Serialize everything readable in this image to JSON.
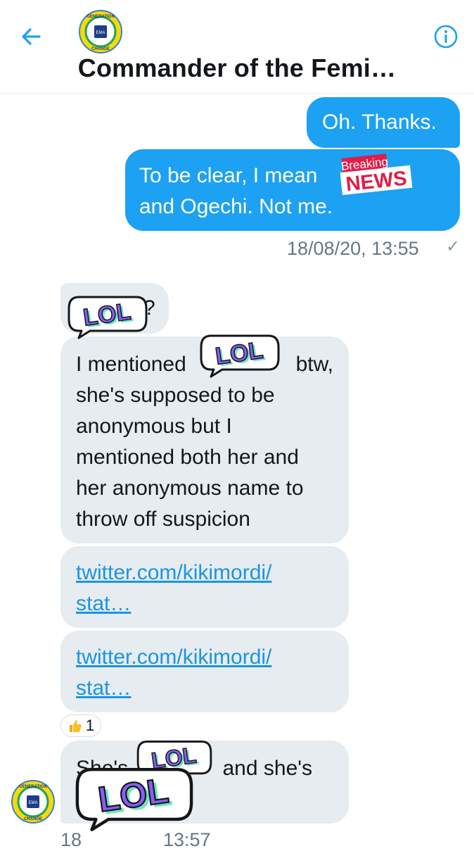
{
  "header": {
    "title": "Commander of the Femi…",
    "avatar_text_top": "GENERATION",
    "avatar_text_bottom": "CHANGE",
    "avatar_badge": "EMA"
  },
  "messages": {
    "out1": "Oh. Thanks.",
    "out2_line1": "To be clear, I mean",
    "out2_line2": "and Ogechi. Not me.",
    "out_timestamp": "18/08/20, 13:55",
    "out_check": "✓",
    "in1_tail": "?",
    "in2_line1_start": "I mentioned",
    "in2_line1_end": "btw,",
    "in2_line2": "she's supposed to be",
    "in2_line3": "anonymous but I",
    "in2_line4": "mentioned both her and",
    "in2_line5": "her anonymous name to",
    "in2_line6": "throw off suspicion",
    "link1_line1": "twitter.com/kikimordi/",
    "link1_line2": "stat…",
    "link2_line1": "twitter.com/kikimordi/",
    "link2_line2": "stat…",
    "reaction_count": "1",
    "in5_start": "She's",
    "in5_end": "and she's",
    "in_timestamp_partial": "18",
    "in_timestamp_partial_end": "13:57"
  },
  "stickers": {
    "lol": "LOL",
    "breaking_top": "Breaking",
    "breaking_bottom": "NEWS"
  },
  "colors": {
    "accent": "#1da1f2",
    "incoming_bubble": "#e6ecf0",
    "link": "#1b95e0",
    "meta_text": "#657786",
    "sticker_purple": "#8b5cf6",
    "sticker_green": "#6ee7b7",
    "news_red": "#e11d48"
  }
}
